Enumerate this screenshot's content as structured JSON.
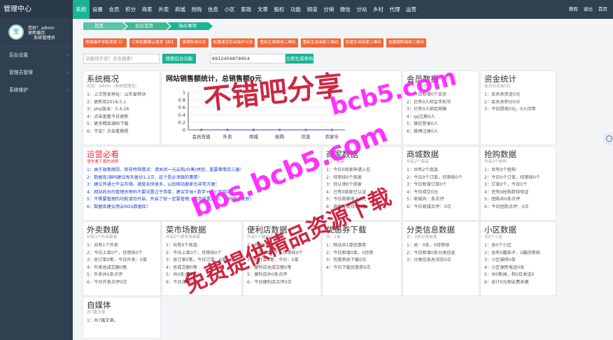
{
  "app": {
    "title": "管理中心"
  },
  "nav": {
    "items": [
      "系统",
      "设置",
      "会员",
      "积分",
      "商家",
      "外卖",
      "商城",
      "抢购",
      "信息",
      "小区",
      "家政",
      "文章",
      "股权",
      "功能",
      "频道",
      "分销",
      "微信",
      "分站",
      "乡村",
      "代理",
      "运营"
    ],
    "active": "系统"
  },
  "topright": [
    "教程",
    "退出",
    "首页"
  ],
  "user": {
    "greeting": "您好！admin",
    "cache": "更新缓存",
    "role": "系统管理员",
    "avatar": "宝"
  },
  "sidebar": {
    "items": [
      "后台设置",
      "管理员管理",
      "系统维护"
    ]
  },
  "breadcrumb": [
    "首页",
    "后台首页",
    "待办事项"
  ],
  "actions": [
    "快捷操作导航菜单 》》",
    "订单批量确认收货【新】",
    "清理系统日志",
    "批量清空后台操作日志",
    "重新生成微信二维码",
    "重新生成商家二维码",
    "批量生成商家二维码",
    "批量删除商家二维码"
  ],
  "search": {
    "placeholder": "功能找不到？点击搜索！",
    "button": "搜索后台功能",
    "phone_value": "6912456878954",
    "phone_button": "立即生成条码"
  },
  "cards": {
    "system": {
      "title": "系统概况",
      "sub": "欢迎：admin（系统管理员）",
      "lines": [
        "1：上次登录地址：山东省移动",
        "2：更新到2018.5.1",
        "3：php版本：5.4.28",
        "4：点击查看今日更新",
        "5：更多精品源码下载",
        "6：不会？点击看教程"
      ]
    },
    "members": {
      "title": "会员数据",
      "sub": "共 1 个会员",
      "lines": [
        "1：今日新增0个会员",
        "2：已有0人验证手机号",
        "3：已有0人绑定邮箱",
        "4：qq注册0人",
        "5：微信登录0人",
        "6：微博注册0人"
      ]
    },
    "funds": {
      "title": "资金统计",
      "sub": "会员总资金0元",
      "lines": [
        "1：会员总资金0元",
        "2：会员总积分0分",
        "3：今日提现0元，0人待审"
      ]
    },
    "ops": {
      "title": "运营必看",
      "sub": "请先看下面的说明",
      "lines": [
        "1：由于政策原因，除非特殊情况：请关闭一元云购/众筹/拼团，重要事情说三遍！",
        "2：数据库/源码建议每天备份1-2次，这个是必须做的事情！",
        "3：建议开通七牛云存储，速度会快很多，以后网站搬家也非常方便！",
        "4：网站后台的管理员密码不要设置过于简单，建议字母+数字+大小写结合！",
        "5：不需要管理的功能请勿开启，开启了就一定要管理，切勿放置弃码，否则停止更新！",
        "6：数据库建议用云RDS数据库！"
      ]
    },
    "shops": {
      "title": "商家数据",
      "sub": "共1个商家",
      "lines": [
        "1：今日0商家申请入驻",
        "2：待审核0个商家",
        "3：待认领0个商家",
        "4：已有0商家已认证",
        "5：今日商家收入0元",
        "6：商家提现待审0笔"
      ]
    },
    "mall": {
      "title": "商城数据",
      "sub": "共有2个商品",
      "lines": [
        "1：共有2个商品",
        "2：今日0个订单，待审核0个",
        "3：今日新增订单0个",
        "4：今日成交0元",
        "5：商城共：条点评",
        "6：今日商城点评：0次"
      ]
    },
    "flash": {
      "title": "抢购数据",
      "sub": "共有0个抢购",
      "lines": [
        "1：共有0个抢购",
        "2：今日0个订单，待审核0个",
        "3：订单0个，今日0个",
        "4：还有0抢购券待验证",
        "5：团购共0条点评",
        "6：今日团购点评：0次"
      ]
    },
    "takeout": {
      "title": "外卖数据",
      "sub": "共有1个外卖商家",
      "lines": [
        "1：共有1个外卖",
        "2：今日上单0个，待审核0个",
        "3：总订单0笔，今日外卖：0单",
        "4：外卖总成交额0笔",
        "5：外卖共0条点评",
        "6：今日外卖点评0次"
      ]
    },
    "market": {
      "title": "菜市场数据",
      "sub": "共有0个菜市场商家",
      "lines": [
        "1：共有0个商品",
        "2：今日上单0个，待审核0个",
        "3：总订单0笔，今日订单：0单",
        "4：总成交额0笔",
        "5：共0条点评",
        "6：今日点评0次"
      ]
    },
    "store": {
      "title": "便利店数据",
      "sub": "共有0个便利店商家",
      "lines": [
        "1：共有0个商品",
        "2：今日上单0个，待审核0个",
        "3：总订单0笔，今日：0单",
        "4：便利店总成交额0笔",
        "5：便利店共0条点评",
        "6：今日便利店点评0次"
      ]
    },
    "coupon": {
      "title": "优惠券下载",
      "sub": "共：1单",
      "lines": [
        "1：网站共1单优惠券",
        "2：今日新增0单，0待审",
        "3：优惠券总下载0次",
        "4：今日下载优惠券0次"
      ]
    },
    "classified": {
      "title": "分类信息数据",
      "sub": "总：0条分类信息",
      "lines": [
        "1：总：0条，0待审核",
        "2：今日新增0条分类信息",
        "3：分类信息总浏览0次"
      ]
    },
    "community": {
      "title": "小区数据",
      "sub": "总0个小区",
      "lines": [
        "1：总0个小区",
        "2：总有0篇帖子，0篇待审核",
        "3：小区报修0条",
        "4：小区便民电话0条",
        "5：共0新闻，和0日发送0",
        "6：总计0元物业费未缴"
      ]
    },
    "media": {
      "title": "自媒体",
      "sub": "总7篇文章",
      "lines": [
        "1：共7篇文章。"
      ]
    }
  },
  "chart_data": {
    "type": "line",
    "title": "网站销售额统计，总销售额0元",
    "categories": [
      "会员充值",
      "外卖",
      "商城",
      "抢购",
      "信息",
      "农家乐"
    ],
    "values": [
      0,
      0,
      0,
      0,
      0,
      0
    ],
    "yticks": [
      0,
      0.2,
      0.4,
      0.6,
      0.8,
      1
    ],
    "ylim": [
      0,
      1
    ],
    "xlabel": "",
    "ylabel": "",
    "grid": true,
    "colors": {
      "line": "#4b77be",
      "axis": "#333"
    }
  },
  "watermarks": [
    "不错吧分享",
    "bcb5.com",
    "bbs.bcb5.com",
    "免费提供精品资源下载"
  ],
  "colors": {
    "accent": "#1ab394",
    "sidebar": "#2f4050",
    "orange": "#f0683a",
    "watermark": "#ff1cff",
    "watermark_ink": "#c8102e"
  }
}
